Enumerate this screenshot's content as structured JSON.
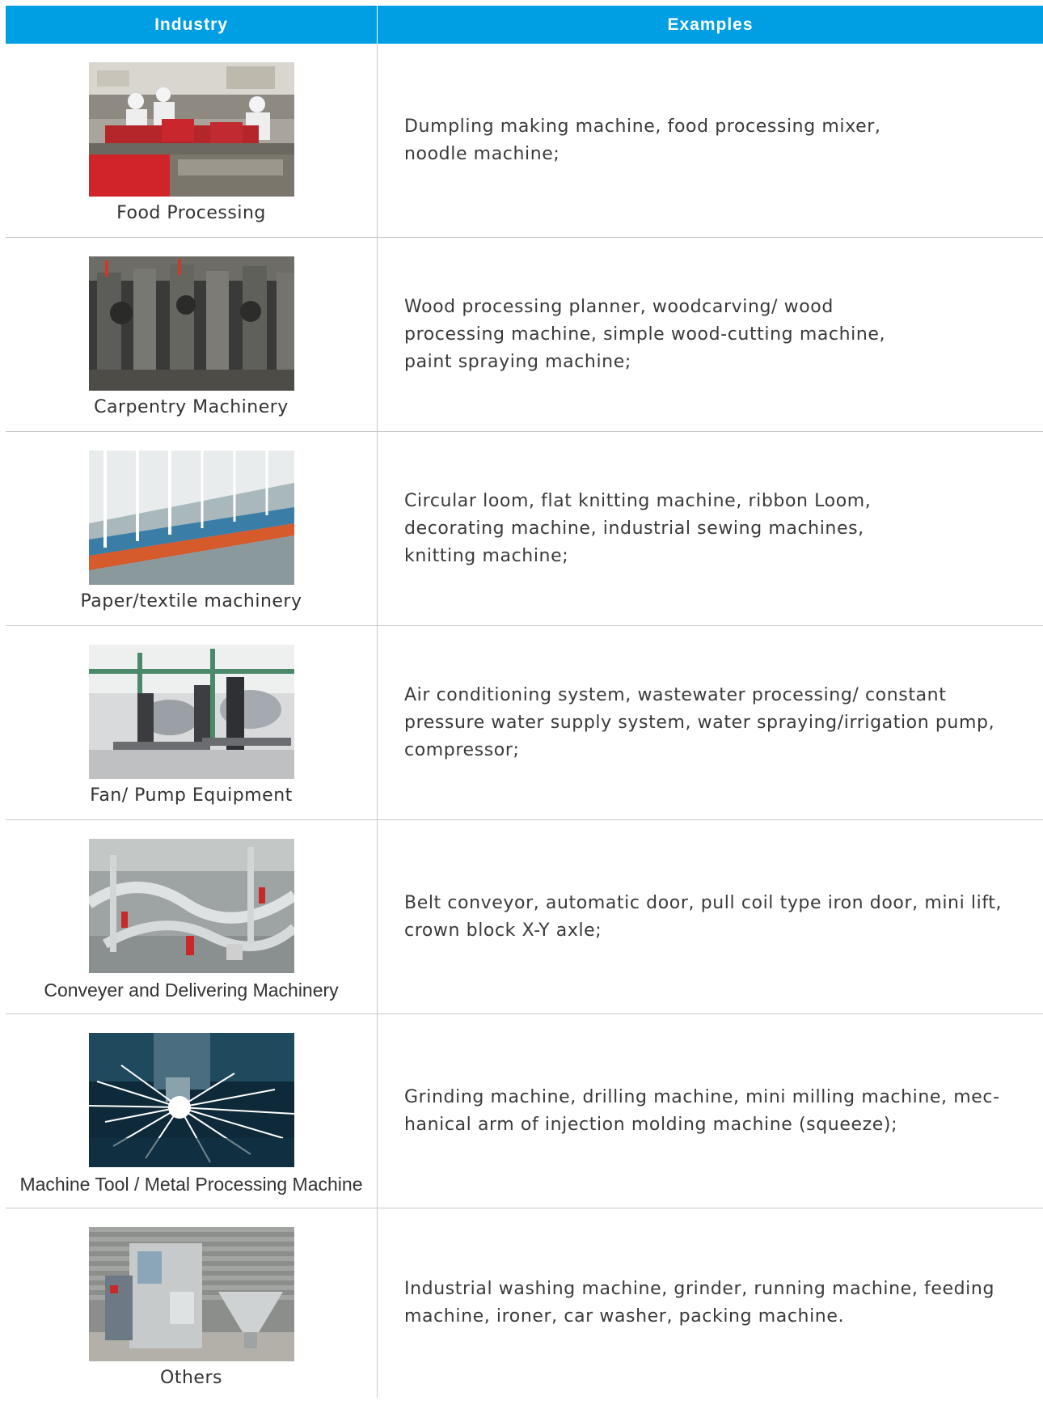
{
  "header": {
    "industry_label": "Industry",
    "examples_label": "Examples",
    "color": "#009fe3"
  },
  "rows": [
    {
      "industry": "Food Processing",
      "photo_icon": "food-processing-photo",
      "examples": [
        "Dumpling making machine, food processing mixer,",
        "noodle machine;"
      ]
    },
    {
      "industry": "Carpentry Machinery",
      "photo_icon": "carpentry-machinery-photo",
      "examples": [
        "Wood processing planner, woodcarving/ wood",
        "processing machine, simple wood-cutting machine,",
        "paint spraying machine;"
      ]
    },
    {
      "industry": "Paper/textile machinery",
      "photo_icon": "textile-machinery-photo",
      "examples": [
        "Circular loom, flat knitting machine, ribbon Loom,",
        "decorating machine, industrial sewing machines,",
        "knitting machine;"
      ]
    },
    {
      "industry": "Fan/ Pump Equipment",
      "photo_icon": "pump-equipment-photo",
      "examples": [
        "Air conditioning system, wastewater processing/ constant",
        "pressure water supply system, water spraying/irrigation pump,",
        "compressor;"
      ]
    },
    {
      "industry": "Conveyer and Delivering Machinery",
      "photo_icon": "conveyor-machinery-photo",
      "examples": [
        "Belt conveyor, automatic door, pull coil type iron door, mini lift,",
        "crown block X-Y axle;"
      ]
    },
    {
      "industry": "Machine Tool / Metal Processing Machine",
      "photo_icon": "metal-processing-photo",
      "examples": [
        "Grinding machine, drilling machine, mini milling machine, mec-",
        "hanical arm of injection molding machine (squeeze);"
      ]
    },
    {
      "industry": "Others",
      "photo_icon": "packing-machine-photo",
      "examples": [
        "Industrial washing machine, grinder, running machine, feeding",
        "machine, ironer, car washer, packing machine."
      ]
    }
  ]
}
